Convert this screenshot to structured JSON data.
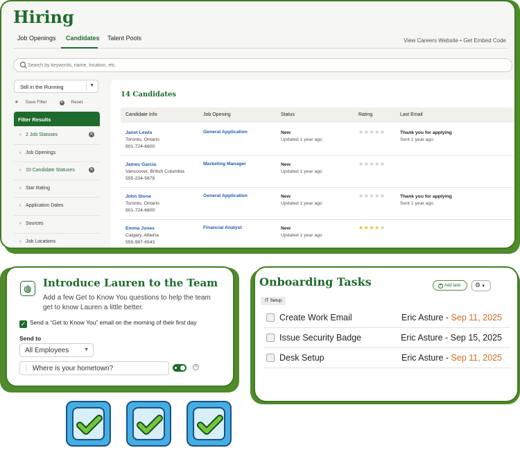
{
  "hiring": {
    "title": "Hiring",
    "tabs": [
      {
        "label": "Job Openings"
      },
      {
        "label": "Candidates"
      },
      {
        "label": "Talent Pools"
      }
    ],
    "links": "View Careers Website  •  Get Embed Code",
    "search_placeholder": "Search by keywords, name, location, etc.",
    "filter_select": "Still in the Running",
    "save_filter": "Save Filter",
    "reset": "Reset",
    "filter_results": "Filter Results",
    "filters": [
      {
        "label": "2 Job Statuses",
        "active": true
      },
      {
        "label": "Job Openings",
        "active": false
      },
      {
        "label": "10 Candidate Statuses",
        "active": true
      },
      {
        "label": "Star Rating",
        "active": false
      },
      {
        "label": "Application Dates",
        "active": false
      },
      {
        "label": "Sources",
        "active": false
      },
      {
        "label": "Job Locations",
        "active": false
      }
    ],
    "candidates_count": "14 Candidates",
    "columns": [
      "Candidate Info",
      "Job Opening",
      "Status",
      "Rating",
      "Last Email"
    ],
    "rows": [
      {
        "name": "Janet Lewis",
        "location": "Toronto, Ontario",
        "phone": "801-724-6600",
        "job": "General Application",
        "status": "New",
        "updated": "Updated 1 year ago",
        "rating": 0,
        "email": "Thank you for applying",
        "sent": "Sent 1 year ago"
      },
      {
        "name": "James Garcia",
        "location": "Vancouver, British Columbia",
        "phone": "555-234-5678",
        "job": "Marketing Manager",
        "status": "New",
        "updated": "Updated 1 year ago",
        "rating": 0,
        "email": "",
        "sent": ""
      },
      {
        "name": "John Stone",
        "location": "Toronto, Ontario",
        "phone": "801-724-6600",
        "job": "General Application",
        "status": "New",
        "updated": "Updated 1 year ago",
        "rating": 0,
        "email": "Thank you for applying",
        "sent": "Sent 1 year ago"
      },
      {
        "name": "Emma Jones",
        "location": "Calgary, Alberta",
        "phone": "555-987-6543",
        "job": "Financial Analyst",
        "status": "New",
        "updated": "Updated 1 year ago",
        "rating": 4,
        "email": "",
        "sent": ""
      }
    ]
  },
  "intro": {
    "title": "Introduce Lauren to the Team",
    "description": "Add a few Get to Know You questions to help the team get to know Lauren a little better.",
    "send_checkbox": "Send a “Get to Know You” email on the morning of their first day",
    "send_to_label": "Send to",
    "send_to_value": "All Employees",
    "question": "Where is your hometown?"
  },
  "onboarding": {
    "title": "Onboarding Tasks",
    "add_task": "Add task",
    "section": "IT Setup",
    "tasks": [
      {
        "label": "Create Work Email",
        "assignee": "Eric Asture - ",
        "due": "Sep 11, 2025",
        "late": true
      },
      {
        "label": "Issue Security Badge",
        "assignee": "Eric Asture - ",
        "due": "Sep 15, 2025",
        "late": false
      },
      {
        "label": "Desk Setup",
        "assignee": "Eric Asture - ",
        "due": "Sep 11, 2025",
        "late": true
      }
    ]
  },
  "colors": {
    "brand_green": "#1f6b2e",
    "link_blue": "#1d58b5",
    "late_orange": "#d06a23",
    "star_yellow": "#f0c018",
    "badge_blue": "#46aee0"
  },
  "icons": [
    "search-icon",
    "star-icon",
    "x-circle-icon",
    "chevron-right-icon",
    "chevron-down-icon",
    "wave-hand-icon",
    "check-icon",
    "drag-handle-icon",
    "plus-circle-icon",
    "gear-icon"
  ]
}
